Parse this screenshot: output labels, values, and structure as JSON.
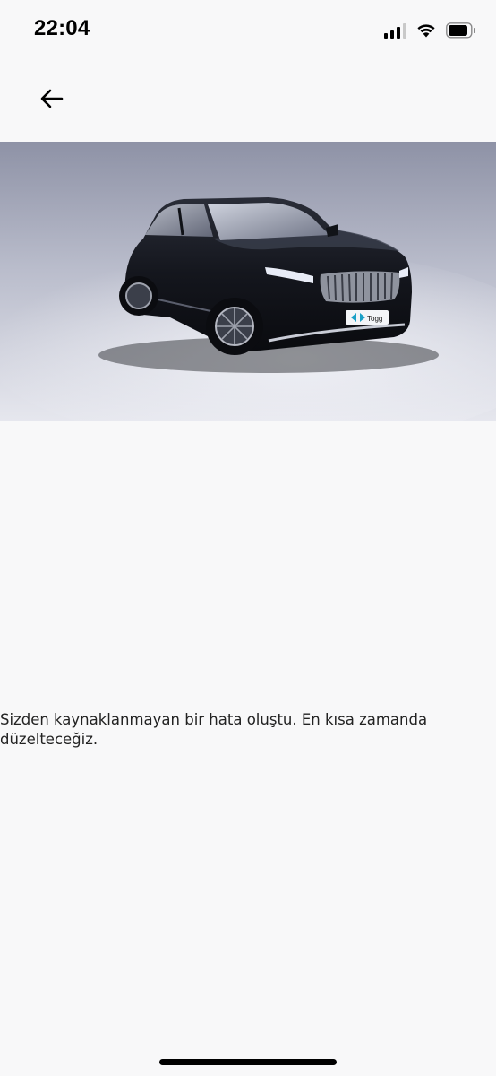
{
  "status_bar": {
    "time": "22:04",
    "icons": [
      "cellular-signal-icon",
      "wifi-icon",
      "battery-icon"
    ]
  },
  "nav": {
    "back_icon": "arrow-left-icon"
  },
  "hero": {
    "image_subject": "black-suv-car-image",
    "badge_text": "Togg"
  },
  "error": {
    "message": "Sizden kaynaklanmayan bir hata oluştu. En kısa zamanda düzelteceğiz."
  },
  "colors": {
    "background": "#f8f8f9",
    "text": "#222222",
    "hero_backdrop": "#b9bccb"
  }
}
